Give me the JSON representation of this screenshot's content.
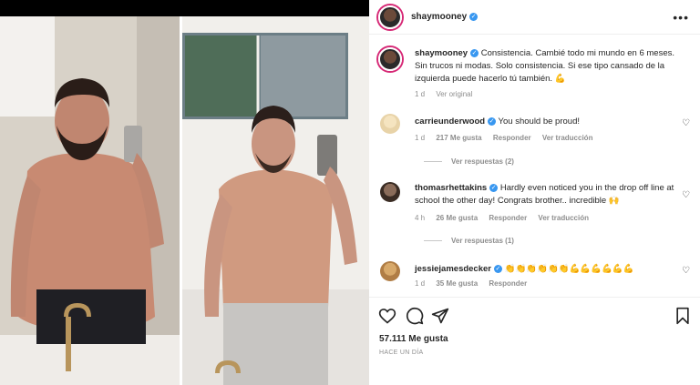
{
  "post": {
    "username": "shaymooney",
    "caption": "Consistencia. Cambié todo mi mundo en 6 meses. Sin trucos ni modas. Solo consistencia. Si ese tipo cansado de la izquierda puede hacerlo tú también. 💪",
    "caption_time": "1 d",
    "see_translation": "Ver original",
    "likes": "57.111 Me gusta",
    "timestamp": "HACE UN DÍA"
  },
  "comments": [
    {
      "username": "carrieunderwood",
      "text": "You should be proud!",
      "time": "1 d",
      "likes": "217 Me gusta",
      "reply": "Responder",
      "translate": "Ver traducción",
      "replies": "Ver respuestas (2)"
    },
    {
      "username": "thomasrhettakins",
      "text": "Hardly even noticed you in the drop off line at school the other day! Congrats brother.. incredible 🙌",
      "time": "4 h",
      "likes": "26 Me gusta",
      "reply": "Responder",
      "translate": "Ver traducción",
      "replies": "Ver respuestas (1)"
    },
    {
      "username": "jessiejamesdecker",
      "text": "👏👏👏👏👏👏💪💪💪💪💪💪",
      "time": "1 d",
      "likes": "35 Me gusta",
      "reply": "Responder"
    }
  ],
  "icons": {
    "heart": "heart-icon",
    "comment": "comment-icon",
    "share": "share-icon",
    "save": "bookmark-icon",
    "more": "more-options-icon"
  },
  "colors": {
    "verified": "#3897f0",
    "muted": "#8e8e8e",
    "text": "#262626"
  }
}
